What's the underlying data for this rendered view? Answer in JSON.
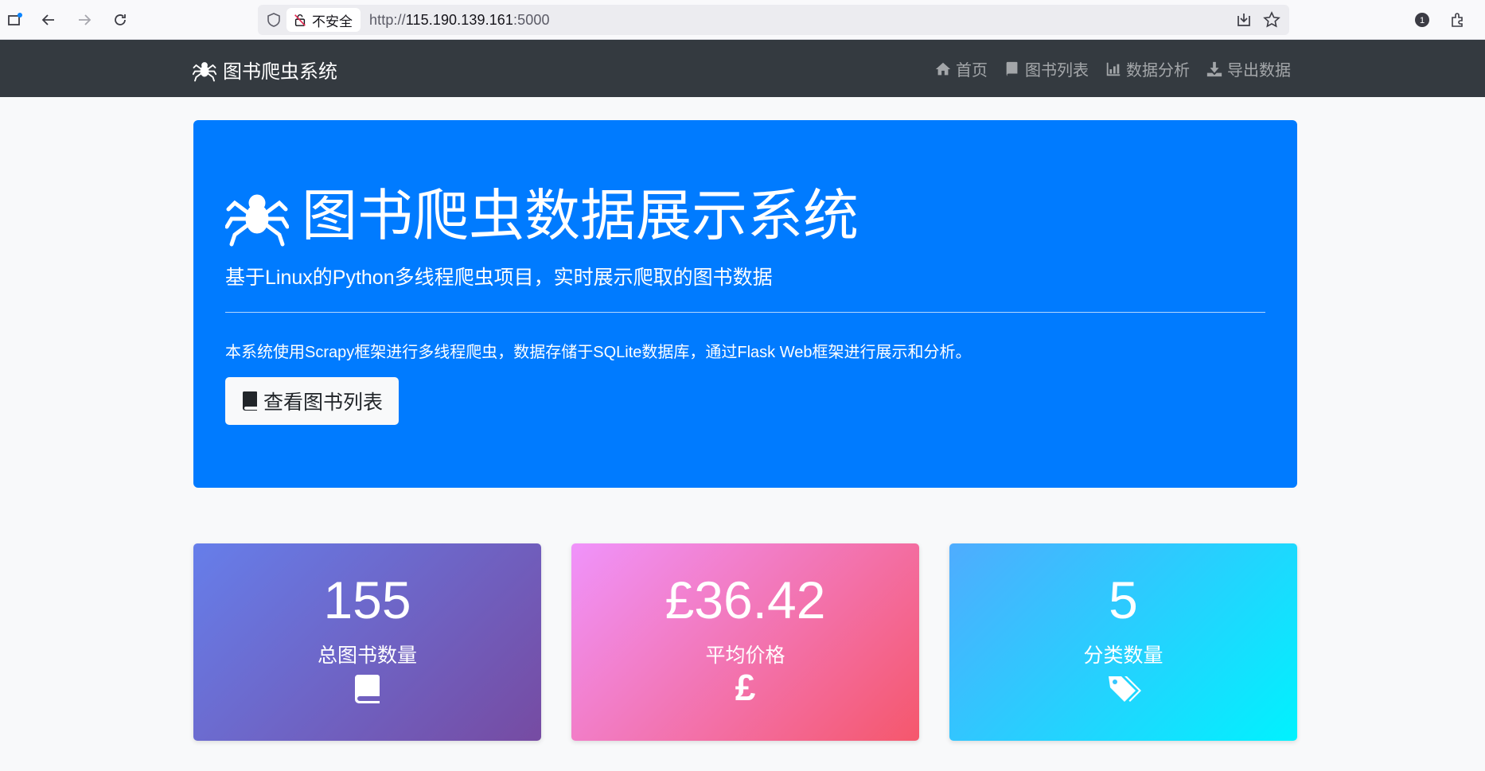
{
  "browser": {
    "insecure_label": "不安全",
    "url_scheme": "http://",
    "url_host": "115.190.139.161",
    "url_port": ":5000",
    "notification_count": "1"
  },
  "navbar": {
    "brand": "图书爬虫系统",
    "items": [
      {
        "label": "首页",
        "icon": "home-icon"
      },
      {
        "label": "图书列表",
        "icon": "book-icon"
      },
      {
        "label": "数据分析",
        "icon": "chart-icon"
      },
      {
        "label": "导出数据",
        "icon": "download-icon"
      }
    ]
  },
  "hero": {
    "title": "图书爬虫数据展示系统",
    "lead": "基于Linux的Python多线程爬虫项目，实时展示爬取的图书数据",
    "description": "本系统使用Scrapy框架进行多线程爬虫，数据存储于SQLite数据库，通过Flask Web框架进行展示和分析。",
    "button_label": "查看图书列表"
  },
  "stats": [
    {
      "value": "155",
      "label": "总图书数量",
      "icon": "book-icon"
    },
    {
      "value": "£36.42",
      "label": "平均价格",
      "icon": "pound-icon",
      "icon_glyph": "£"
    },
    {
      "value": "5",
      "label": "分类数量",
      "icon": "tags-icon"
    }
  ],
  "colors": {
    "navbar": "#343a40",
    "hero": "#007bff",
    "card1_gradient": [
      "#667eea",
      "#764ba2"
    ],
    "card2_gradient": [
      "#f093fb",
      "#f5576c"
    ],
    "card3_gradient": [
      "#4facfe",
      "#00f2fe"
    ]
  }
}
